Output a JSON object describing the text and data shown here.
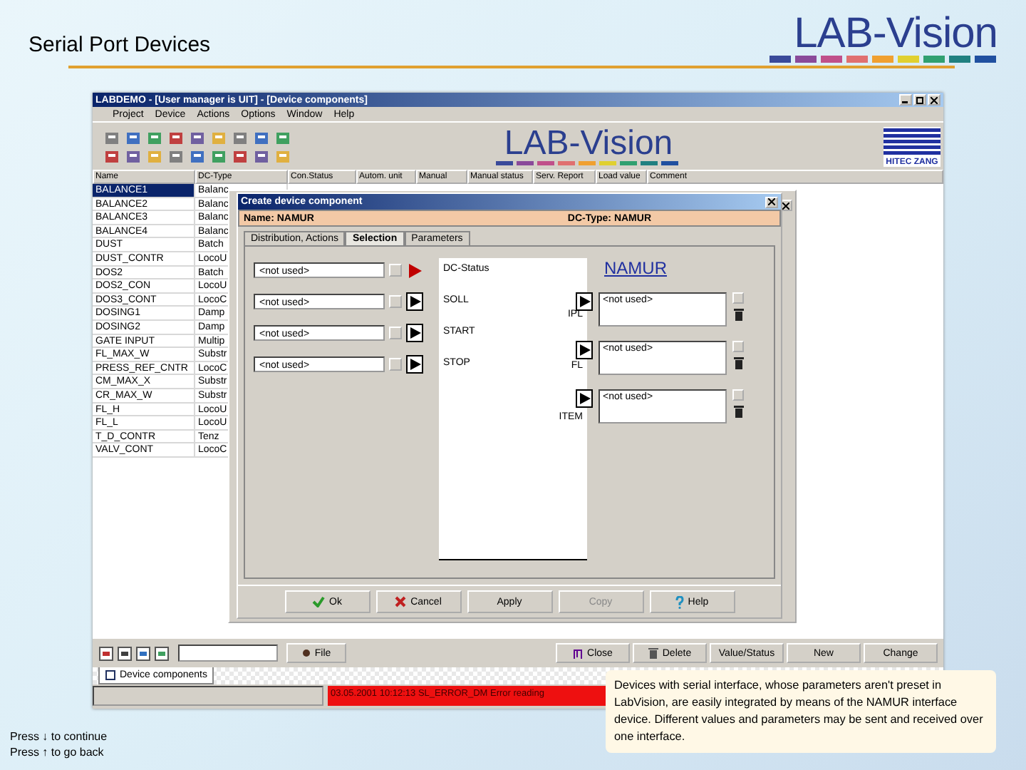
{
  "slide": {
    "title": "Serial Port Devices",
    "logo": "LAB-Vision"
  },
  "app": {
    "title": "LABDEMO - [User manager is UIT] - [Device components]",
    "menu": [
      "Project",
      "Device",
      "Actions",
      "Options",
      "Window",
      "Help"
    ],
    "toolbar_logo": "LAB-Vision",
    "company_logo": "HITEC ZANG",
    "table": {
      "columns": [
        "Name",
        "DC-Type",
        "Con.Status",
        "Autom. unit",
        "Manual",
        "Manual status",
        "Serv. Report",
        "Load value",
        "Comment"
      ],
      "rows": [
        {
          "cells": [
            "BALANCE1",
            "Balanc"
          ],
          "selected": true
        },
        {
          "cells": [
            "BALANCE2",
            "Balanc"
          ],
          "selected": false
        },
        {
          "cells": [
            "BALANCE3",
            "Balanc"
          ],
          "selected": false
        },
        {
          "cells": [
            "BALANCE4",
            "Balanc"
          ],
          "selected": false
        },
        {
          "cells": [
            "DUST",
            "Batch"
          ],
          "selected": false
        },
        {
          "cells": [
            "DUST_CONTR",
            "LocoU"
          ],
          "selected": false
        },
        {
          "cells": [
            "DOS2",
            "Batch"
          ],
          "selected": false
        },
        {
          "cells": [
            "DOS2_CON",
            "LocoU"
          ],
          "selected": false
        },
        {
          "cells": [
            "DOS3_CONT",
            "LocoC"
          ],
          "selected": false
        },
        {
          "cells": [
            "DOSING1",
            "Damp"
          ],
          "selected": false
        },
        {
          "cells": [
            "DOSING2",
            "Damp"
          ],
          "selected": false
        },
        {
          "cells": [
            "GATE INPUT",
            "Multip"
          ],
          "selected": false
        },
        {
          "cells": [
            "FL_MAX_W",
            "Substr"
          ],
          "selected": false
        },
        {
          "cells": [
            "PRESS_REF_CNTR",
            "LocoC"
          ],
          "selected": false
        },
        {
          "cells": [
            "CM_MAX_X",
            "Substr"
          ],
          "selected": false
        },
        {
          "cells": [
            "CR_MAX_W",
            "Substr"
          ],
          "selected": false
        },
        {
          "cells": [
            "FL_H",
            "LocoU"
          ],
          "selected": false
        },
        {
          "cells": [
            "FL_L",
            "LocoU"
          ],
          "selected": false
        },
        {
          "cells": [
            "T_D_CONTR",
            "Tenz"
          ],
          "selected": false
        },
        {
          "cells": [
            "VALV_CONT",
            "LocoC"
          ],
          "selected": false
        }
      ]
    },
    "dialog": {
      "title": "Create device component",
      "name": "Name: NAMUR",
      "dc_type": "DC-Type: NAMUR",
      "tabs": [
        {
          "label": "Distribution, Actions",
          "selected": false
        },
        {
          "label": "Selection",
          "selected": true
        },
        {
          "label": "Parameters",
          "selected": false
        }
      ],
      "inputs": [
        {
          "value": "<not used>",
          "label": "DC-Status",
          "kind": "status"
        },
        {
          "value": "<not used>",
          "label": "SOLL",
          "kind": "link"
        },
        {
          "value": "<not used>",
          "label": "START",
          "kind": "link"
        },
        {
          "value": "<not used>",
          "label": "STOP",
          "kind": "link"
        }
      ],
      "heading": "NAMUR",
      "outputs": [
        {
          "label": "IPL",
          "value": "<not used>"
        },
        {
          "label": "FL",
          "value": "<not used>"
        },
        {
          "label": "ITEM",
          "value": "<not used>"
        }
      ],
      "buttons": [
        {
          "label": "Ok",
          "kind": "ok",
          "disabled": false
        },
        {
          "label": "Cancel",
          "kind": "cancel",
          "disabled": false
        },
        {
          "label": "Apply",
          "kind": "plain",
          "disabled": false
        },
        {
          "label": "Copy",
          "kind": "plain",
          "disabled": true
        },
        {
          "label": "Help",
          "kind": "help",
          "disabled": false
        }
      ]
    },
    "bottom_bar": {
      "file_button": "File",
      "buttons": [
        {
          "label": "Close",
          "kind": "close"
        },
        {
          "label": "Delete",
          "kind": "delete"
        },
        {
          "label": "Value/Status",
          "kind": "plain"
        },
        {
          "label": "New",
          "kind": "plain"
        },
        {
          "label": "Change",
          "kind": "plain"
        }
      ]
    },
    "tabs": [
      {
        "label": "Device components",
        "selected": true
      }
    ],
    "status": {
      "message": "03.05.2001 10:12:13 SL_ERROR_DM Error reading"
    }
  },
  "footer": {
    "hints": [
      "Press ↓ to continue",
      "Press ↑ to go back"
    ]
  },
  "callout": "Devices with serial interface, whose parameters aren't preset in LabVision, are easily integrated by means of the NAMUR interface device. Different values and parameters may be sent and received over one interface."
}
